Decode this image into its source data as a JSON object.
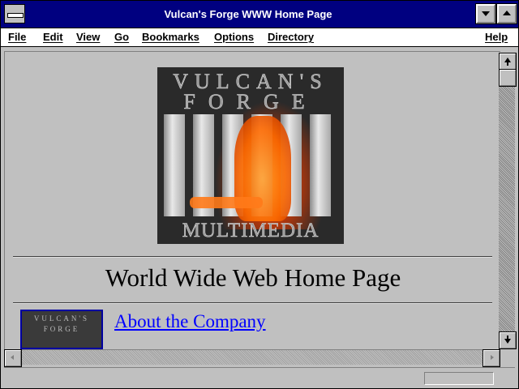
{
  "window": {
    "title": "Vulcan's Forge WWW Home Page"
  },
  "menu": {
    "file": "File",
    "edit": "Edit",
    "view": "View",
    "go": "Go",
    "bookmarks": "Bookmarks",
    "options": "Options",
    "directory": "Directory",
    "help": "Help"
  },
  "logo": {
    "line1": "VULCAN'S",
    "line2": "FORGE",
    "line3": "MULTIMEDIA"
  },
  "page": {
    "heading": "World Wide Web Home Page",
    "links": [
      {
        "label": "About the Company"
      }
    ]
  },
  "thumb": {
    "line1": "VULCAN'S",
    "line2": "FORGE"
  },
  "colors": {
    "titlebar": "#000080",
    "link": "#0000ff",
    "chrome": "#c0c0c0",
    "desktop": "#008080"
  },
  "icons": {
    "system_menu": "system-menu-icon",
    "minimize": "minimize-icon",
    "maximize": "maximize-icon",
    "scroll_up": "scroll-up-icon",
    "scroll_down": "scroll-down-icon",
    "scroll_left": "scroll-left-icon",
    "scroll_right": "scroll-right-icon"
  }
}
